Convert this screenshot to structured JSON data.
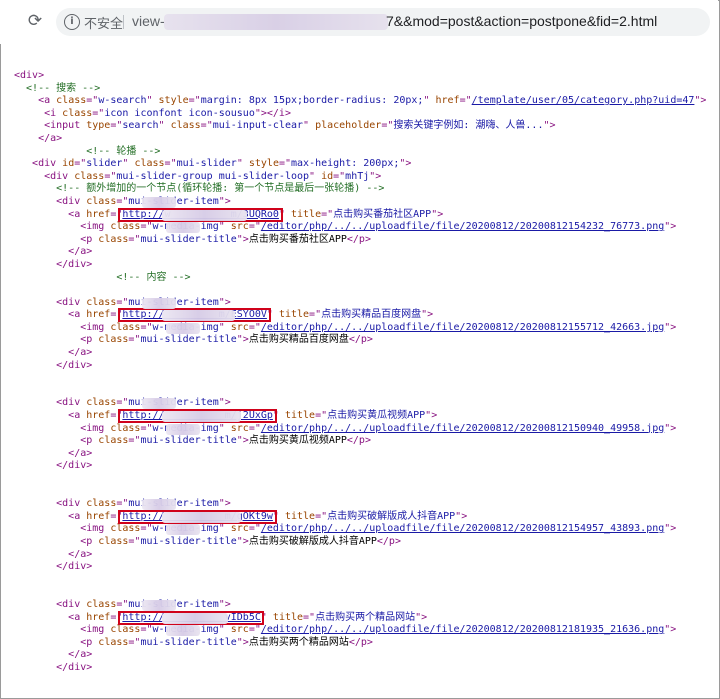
{
  "browser": {
    "reload_glyph": "⟳",
    "info_glyph": "i",
    "security_label": "不安全",
    "url_prefix": "view-",
    "url_suffix": "7&&mod=post&action=postpone&fid=2.html"
  },
  "code_lines": [
    [
      [
        "tag",
        "<div>"
      ]
    ],
    [
      [
        "cmt",
        "  <!-- 搜索 -->"
      ]
    ],
    [
      [
        "tag",
        "    <a "
      ],
      [
        "attr",
        "class"
      ],
      [
        "tag",
        "=\""
      ],
      [
        "val",
        "w-search"
      ],
      [
        "tag",
        "\" "
      ],
      [
        "attr",
        "style"
      ],
      [
        "tag",
        "=\""
      ],
      [
        "val",
        "margin: 8px 15px;border-radius: 20px;"
      ],
      [
        "tag",
        "\" "
      ],
      [
        "attr",
        "href"
      ],
      [
        "tag",
        "=\""
      ],
      [
        "lnk",
        "/template/user/05/category.php?uid=47"
      ],
      [
        "tag",
        "\">"
      ]
    ],
    [
      [
        "tag",
        "     <i "
      ],
      [
        "attr",
        "class"
      ],
      [
        "tag",
        "=\""
      ],
      [
        "val",
        "icon iconfont icon-sousuo"
      ],
      [
        "tag",
        "\"></i>"
      ]
    ],
    [
      [
        "tag",
        "     <input "
      ],
      [
        "attr",
        "type"
      ],
      [
        "tag",
        "=\""
      ],
      [
        "val",
        "search"
      ],
      [
        "tag",
        "\" "
      ],
      [
        "attr",
        "class"
      ],
      [
        "tag",
        "=\""
      ],
      [
        "val",
        "mui-input-clear"
      ],
      [
        "tag",
        "\" "
      ],
      [
        "attr",
        "placeholder"
      ],
      [
        "tag",
        "=\""
      ],
      [
        "val",
        "搜索关键字例如: 潮嗨、人兽..."
      ],
      [
        "tag",
        "\">"
      ]
    ],
    [
      [
        "tag",
        "    </a>"
      ]
    ],
    [
      [
        "cmt",
        "            <!-- 轮播 -->"
      ]
    ],
    [
      [
        "tag",
        "   <div "
      ],
      [
        "attr",
        "id"
      ],
      [
        "tag",
        "=\""
      ],
      [
        "val",
        "slider"
      ],
      [
        "tag",
        "\" "
      ],
      [
        "attr",
        "class"
      ],
      [
        "tag",
        "=\""
      ],
      [
        "val",
        "mui-slider"
      ],
      [
        "tag",
        "\" "
      ],
      [
        "attr",
        "style"
      ],
      [
        "tag",
        "=\""
      ],
      [
        "val",
        "max-height: 200px;"
      ],
      [
        "tag",
        "\">"
      ]
    ],
    [
      [
        "tag",
        "     <div "
      ],
      [
        "attr",
        "class"
      ],
      [
        "tag",
        "=\""
      ],
      [
        "val",
        "mui-slider-group mui-slider-loop"
      ],
      [
        "tag",
        "\" "
      ],
      [
        "attr",
        "id"
      ],
      [
        "tag",
        "=\""
      ],
      [
        "val",
        "mhTj"
      ],
      [
        "tag",
        "\">"
      ]
    ],
    [
      [
        "cmt",
        "       <!-- 额外增加的一个节点(循环轮播: 第一个节点是最后一张轮播) -->"
      ]
    ],
    [
      [
        "tag",
        "       <div "
      ],
      [
        "attr",
        "class"
      ],
      [
        "tag",
        "=\""
      ],
      [
        "val",
        "mui-slider-item"
      ],
      [
        "tag",
        "\">"
      ]
    ],
    [
      [
        "tag",
        "         <a "
      ],
      [
        "attr",
        "href"
      ],
      [
        "tag",
        "=\""
      ],
      [
        "lnk",
        "http://w          m/3UQRo0"
      ],
      [
        "tag",
        "\" "
      ],
      [
        "attr",
        "title"
      ],
      [
        "tag",
        "=\""
      ],
      [
        "val",
        "点击购买番茄社区APP"
      ],
      [
        "tag",
        "\">"
      ]
    ],
    [
      [
        "tag",
        "           <img "
      ],
      [
        "attr",
        "class"
      ],
      [
        "tag",
        "=\""
      ],
      [
        "val",
        "w-media-img"
      ],
      [
        "tag",
        "\" "
      ],
      [
        "attr",
        "src"
      ],
      [
        "tag",
        "=\""
      ],
      [
        "lnk",
        "/editor/php/../../uploadfile/file/20200812/20200812154232_76773.png"
      ],
      [
        "tag",
        "\">"
      ]
    ],
    [
      [
        "tag",
        "           <p "
      ],
      [
        "attr",
        "class"
      ],
      [
        "tag",
        "=\""
      ],
      [
        "val",
        "mui-slider-title"
      ],
      [
        "tag",
        "\">"
      ],
      [
        "txt",
        "点击购买番茄社区APP"
      ],
      [
        "tag",
        "</p>"
      ]
    ],
    [
      [
        "tag",
        "         </a>"
      ]
    ],
    [
      [
        "tag",
        "       </div>"
      ]
    ],
    [
      [
        "cmt",
        "                 <!-- 内容 -->"
      ]
    ],
    [],
    [
      [
        "tag",
        "       <div "
      ],
      [
        "attr",
        "class"
      ],
      [
        "tag",
        "=\""
      ],
      [
        "val",
        "mui-slider-item"
      ],
      [
        "tag",
        "\">"
      ]
    ],
    [
      [
        "tag",
        "         <a "
      ],
      [
        "attr",
        "href"
      ],
      [
        "tag",
        "=\""
      ],
      [
        "lnk",
        "http://         m/ESYO0V"
      ],
      [
        "tag",
        "\" "
      ],
      [
        "attr",
        "title"
      ],
      [
        "tag",
        "=\""
      ],
      [
        "val",
        "点击购买精品百度网盘"
      ],
      [
        "tag",
        "\">"
      ]
    ],
    [
      [
        "tag",
        "           <img "
      ],
      [
        "attr",
        "class"
      ],
      [
        "tag",
        "=\""
      ],
      [
        "val",
        "w-media-img"
      ],
      [
        "tag",
        "\" "
      ],
      [
        "attr",
        "src"
      ],
      [
        "tag",
        "=\""
      ],
      [
        "lnk",
        "/editor/php/../../uploadfile/file/20200812/20200812155712_42663.jpg"
      ],
      [
        "tag",
        "\">"
      ]
    ],
    [
      [
        "tag",
        "           <p "
      ],
      [
        "attr",
        "class"
      ],
      [
        "tag",
        "=\""
      ],
      [
        "val",
        "mui-slider-title"
      ],
      [
        "tag",
        "\">"
      ],
      [
        "txt",
        "点击购买精品百度网盘"
      ],
      [
        "tag",
        "</p>"
      ]
    ],
    [
      [
        "tag",
        "         </a>"
      ]
    ],
    [
      [
        "tag",
        "       </div>"
      ]
    ],
    [],
    [],
    [
      [
        "tag",
        "       <div "
      ],
      [
        "attr",
        "class"
      ],
      [
        "tag",
        "=\""
      ],
      [
        "val",
        "mui-slider-item"
      ],
      [
        "tag",
        "\">"
      ]
    ],
    [
      [
        "tag",
        "         <a "
      ],
      [
        "attr",
        "href"
      ],
      [
        "tag",
        "=\""
      ],
      [
        "lnk",
        "http://          m/j2UxGp"
      ],
      [
        "tag",
        "\" "
      ],
      [
        "attr",
        "title"
      ],
      [
        "tag",
        "=\""
      ],
      [
        "val",
        "点击购买黄瓜视频APP"
      ],
      [
        "tag",
        "\">"
      ]
    ],
    [
      [
        "tag",
        "           <img "
      ],
      [
        "attr",
        "class"
      ],
      [
        "tag",
        "=\""
      ],
      [
        "val",
        "w-media-img"
      ],
      [
        "tag",
        "\" "
      ],
      [
        "attr",
        "src"
      ],
      [
        "tag",
        "=\""
      ],
      [
        "lnk",
        "/editor/php/../../uploadfile/file/20200812/20200812150940_49958.jpg"
      ],
      [
        "tag",
        "\">"
      ]
    ],
    [
      [
        "tag",
        "           <p "
      ],
      [
        "attr",
        "class"
      ],
      [
        "tag",
        "=\""
      ],
      [
        "val",
        "mui-slider-title"
      ],
      [
        "tag",
        "\">"
      ],
      [
        "txt",
        "点击购买黄瓜视频APP"
      ],
      [
        "tag",
        "</p>"
      ]
    ],
    [
      [
        "tag",
        "         </a>"
      ]
    ],
    [
      [
        "tag",
        "       </div>"
      ]
    ],
    [],
    [],
    [
      [
        "tag",
        "       <div "
      ],
      [
        "attr",
        "class"
      ],
      [
        "tag",
        "=\""
      ],
      [
        "val",
        "mui-slider-item"
      ],
      [
        "tag",
        "\">"
      ]
    ],
    [
      [
        "tag",
        "         <a "
      ],
      [
        "attr",
        "href"
      ],
      [
        "tag",
        "=\""
      ],
      [
        "lnk",
        "http://          m/gOKt9w"
      ],
      [
        "tag",
        "\" "
      ],
      [
        "attr",
        "title"
      ],
      [
        "tag",
        "=\""
      ],
      [
        "val",
        "点击购买破解版成人抖音APP"
      ],
      [
        "tag",
        "\">"
      ]
    ],
    [
      [
        "tag",
        "           <img "
      ],
      [
        "attr",
        "class"
      ],
      [
        "tag",
        "=\""
      ],
      [
        "val",
        "w-media-img"
      ],
      [
        "tag",
        "\" "
      ],
      [
        "attr",
        "src"
      ],
      [
        "tag",
        "=\""
      ],
      [
        "lnk",
        "/editor/php/../../uploadfile/file/20200812/20200812154957_43893.png"
      ],
      [
        "tag",
        "\">"
      ]
    ],
    [
      [
        "tag",
        "           <p "
      ],
      [
        "attr",
        "class"
      ],
      [
        "tag",
        "=\""
      ],
      [
        "val",
        "mui-slider-title"
      ],
      [
        "tag",
        "\">"
      ],
      [
        "txt",
        "点击购买破解版成人抖音APP"
      ],
      [
        "tag",
        "</p>"
      ]
    ],
    [
      [
        "tag",
        "         </a>"
      ]
    ],
    [
      [
        "tag",
        "       </div>"
      ]
    ],
    [],
    [],
    [
      [
        "tag",
        "       <div "
      ],
      [
        "attr",
        "class"
      ],
      [
        "tag",
        "=\""
      ],
      [
        "val",
        "mui-slider-item"
      ],
      [
        "tag",
        "\">"
      ]
    ],
    [
      [
        "tag",
        "         <a "
      ],
      [
        "attr",
        "href"
      ],
      [
        "tag",
        "=\""
      ],
      [
        "lnk",
        "http://          vIDb5C"
      ],
      [
        "tag",
        "\" "
      ],
      [
        "attr",
        "title"
      ],
      [
        "tag",
        "=\""
      ],
      [
        "val",
        "点击购买两个精品网站"
      ],
      [
        "tag",
        "\">"
      ]
    ],
    [
      [
        "tag",
        "           <img "
      ],
      [
        "attr",
        "class"
      ],
      [
        "tag",
        "=\""
      ],
      [
        "val",
        "w-media-img"
      ],
      [
        "tag",
        "\" "
      ],
      [
        "attr",
        "src"
      ],
      [
        "tag",
        "=\""
      ],
      [
        "lnk",
        "/editor/php/../../uploadfile/file/20200812/20200812181935_21636.png"
      ],
      [
        "tag",
        "\">"
      ]
    ],
    [
      [
        "tag",
        "           <p "
      ],
      [
        "attr",
        "class"
      ],
      [
        "tag",
        "=\""
      ],
      [
        "val",
        "mui-slider-title"
      ],
      [
        "tag",
        "\">"
      ],
      [
        "txt",
        "点击购买两个精品网站"
      ],
      [
        "tag",
        "</p>"
      ]
    ],
    [
      [
        "tag",
        "         </a>"
      ]
    ],
    [
      [
        "tag",
        "       </div>"
      ]
    ]
  ],
  "highlight_lines": [
    11,
    19,
    27,
    35,
    43
  ],
  "colors": {
    "tag": "#881280",
    "attribute": "#994500",
    "value": "#1a1aa6",
    "comment": "#236e25",
    "highlight_box": "#d0021b"
  }
}
